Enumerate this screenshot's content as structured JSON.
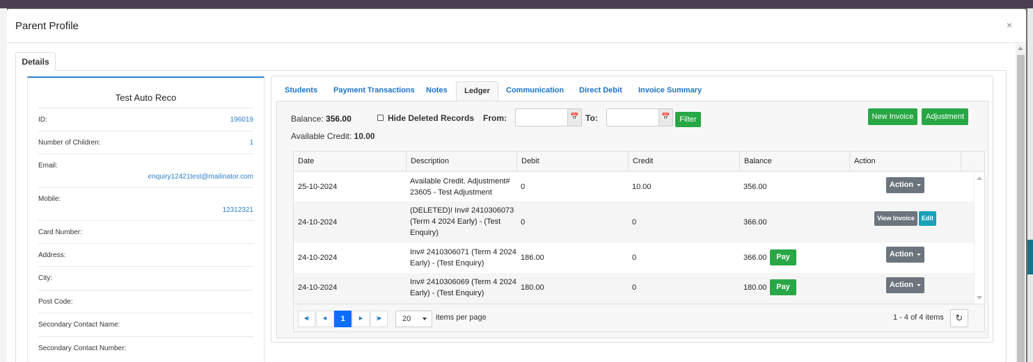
{
  "modal": {
    "title": "Parent Profile",
    "close": "×"
  },
  "details_tab": "Details",
  "profile": {
    "name": "Test Auto Reco",
    "rows": [
      {
        "label": "ID:",
        "value": "196019"
      },
      {
        "label": "Number of Children:",
        "value": "1"
      },
      {
        "label": "Email:",
        "value": "enquiry12421test@mailinator.com"
      },
      {
        "label": "Mobile:",
        "value": "12312321"
      },
      {
        "label": "Card Number:",
        "value": ""
      },
      {
        "label": "Address:",
        "value": ""
      },
      {
        "label": "City:",
        "value": ""
      },
      {
        "label": "Post Code:",
        "value": ""
      },
      {
        "label": "Secondary Contact Name:",
        "value": ""
      },
      {
        "label": "Secondary Contact Number:",
        "value": ""
      }
    ]
  },
  "tabs": [
    "Students",
    "Payment Transactions",
    "Notes",
    "Ledger",
    "Communication",
    "Direct Debit",
    "Invoice Summary"
  ],
  "active_tab": "Ledger",
  "ledger": {
    "balance_label": "Balance:",
    "balance_value": "356.00",
    "available_label": "Available Credit:",
    "available_value": "10.00",
    "hide_deleted_label": "Hide Deleted Records",
    "hide_deleted_checked": false,
    "from_label": "From:",
    "to_label": "To:",
    "from_value": "",
    "to_value": "",
    "filter_label": "Filter",
    "new_invoice_label": "New Invoice",
    "adjustment_label": "Adjustment"
  },
  "grid": {
    "columns": [
      "Date",
      "Description",
      "Debit",
      "Credit",
      "Balance",
      "Action"
    ],
    "rows": [
      {
        "date": "25-10-2024",
        "description": [
          "Available Credit. Adjustment#",
          "23605 - Test Adjustment"
        ],
        "debit": "0",
        "credit": "10.00",
        "balance": "356.00",
        "pay": "",
        "actions": [
          "Action"
        ]
      },
      {
        "date": "24-10-2024",
        "description": [
          "(DELETED)! Inv# 2410306073",
          "(Term 4 2024 Early) - (Test",
          "Enquiry)"
        ],
        "debit": "0",
        "credit": "0",
        "balance": "366.00",
        "pay": "",
        "actions": [
          "View Invoice",
          "Edit"
        ]
      },
      {
        "date": "24-10-2024",
        "description": [
          "Inv# 2410306071 (Term 4 2024",
          "Early) - (Test Enquiry)"
        ],
        "debit": "186.00",
        "credit": "0",
        "balance": "366.00",
        "pay": "Pay",
        "actions": [
          "Action"
        ]
      },
      {
        "date": "24-10-2024",
        "description": [
          "Inv# 2410306069 (Term 4 2024",
          "Early) - (Test Enquiry)"
        ],
        "debit": "180.00",
        "credit": "0",
        "balance": "180.00",
        "pay": "Pay",
        "actions": [
          "Action"
        ]
      }
    ]
  },
  "pager": {
    "current_page": "1",
    "page_size": "20",
    "per_page_label": "items per page",
    "info": "1 - 4 of 4 items"
  },
  "colors": {
    "primary": "#1a73c8",
    "success": "#28a745",
    "secondary": "#6c757d",
    "info": "#17a2b8",
    "pager_active": "#0d6efd"
  },
  "icons": [
    "close-icon",
    "calendar-icon",
    "caret-down-icon",
    "first-page-icon",
    "prev-page-icon",
    "next-page-icon",
    "last-page-icon",
    "refresh-icon"
  ]
}
